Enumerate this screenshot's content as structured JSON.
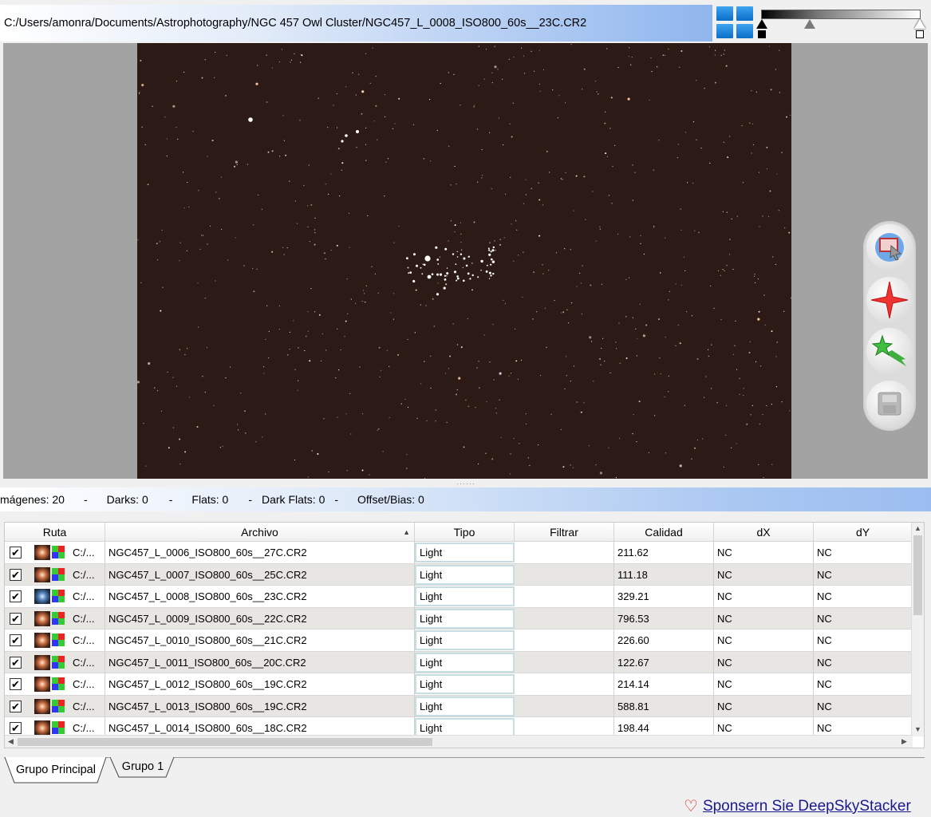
{
  "path_bar": {
    "path": "C:/Users/amonra/Documents/Astrophotography/NGC 457 Owl Cluster/NGC457_L_0008_ISO800_60s__23C.CR2"
  },
  "icons": {
    "tiles": "four-tiles-icon",
    "select_rect": "select-rectangle-icon",
    "star": "star-icon",
    "comet": "comet-icon",
    "save": "save-icon"
  },
  "status": {
    "images": "mágenes: 20",
    "darks": "Darks: 0",
    "flats": "Flats: 0",
    "dark_flats": "Dark Flats: 0",
    "offset": "Offset/Bias: 0",
    "sep": "-"
  },
  "grid": {
    "headers": {
      "ruta": "Ruta",
      "archivo": "Archivo",
      "tipo": "Tipo",
      "filtrar": "Filtrar",
      "calidad": "Calidad",
      "dx": "dX",
      "dy": "dY"
    },
    "rows": [
      {
        "checked": "✔",
        "ruta": "C:/...",
        "archivo": "NGC457_L_0006_ISO800_60s__27C.CR2",
        "tipo": "Light",
        "filtrar": "",
        "calidad": "211.62",
        "dx": "NC",
        "dy": "NC"
      },
      {
        "checked": "✔",
        "ruta": "C:/...",
        "archivo": "NGC457_L_0007_ISO800_60s__25C.CR2",
        "tipo": "Light",
        "filtrar": "",
        "calidad": "111.18",
        "dx": "NC",
        "dy": "NC"
      },
      {
        "checked": "✔",
        "ruta": "C:/...",
        "archivo": "NGC457_L_0008_ISO800_60s__23C.CR2",
        "tipo": "Light",
        "filtrar": "",
        "calidad": "329.21",
        "dx": "NC",
        "dy": "NC"
      },
      {
        "checked": "✔",
        "ruta": "C:/...",
        "archivo": "NGC457_L_0009_ISO800_60s__22C.CR2",
        "tipo": "Light",
        "filtrar": "",
        "calidad": "796.53",
        "dx": "NC",
        "dy": "NC"
      },
      {
        "checked": "✔",
        "ruta": "C:/...",
        "archivo": "NGC457_L_0010_ISO800_60s__21C.CR2",
        "tipo": "Light",
        "filtrar": "",
        "calidad": "226.60",
        "dx": "NC",
        "dy": "NC"
      },
      {
        "checked": "✔",
        "ruta": "C:/...",
        "archivo": "NGC457_L_0011_ISO800_60s__20C.CR2",
        "tipo": "Light",
        "filtrar": "",
        "calidad": "122.67",
        "dx": "NC",
        "dy": "NC"
      },
      {
        "checked": "✔",
        "ruta": "C:/...",
        "archivo": "NGC457_L_0012_ISO800_60s__19C.CR2",
        "tipo": "Light",
        "filtrar": "",
        "calidad": "214.14",
        "dx": "NC",
        "dy": "NC"
      },
      {
        "checked": "✔",
        "ruta": "C:/...",
        "archivo": "NGC457_L_0013_ISO800_60s__19C.CR2",
        "tipo": "Light",
        "filtrar": "",
        "calidad": "588.81",
        "dx": "NC",
        "dy": "NC"
      },
      {
        "checked": "✔",
        "ruta": "C:/...",
        "archivo": "NGC457_L_0014_ISO800_60s__18C.CR2",
        "tipo": "Light",
        "filtrar": "",
        "calidad": "198.44",
        "dx": "NC",
        "dy": "NC"
      }
    ]
  },
  "tabs": [
    "Grupo Principal",
    "Grupo 1"
  ],
  "sponsor": {
    "text": "Sponsern Sie DeepSkyStacker"
  },
  "colors": {
    "sky": "#2b1a16",
    "viewer_bg": "#a3a3a3",
    "status_accent": "#9bbdf0"
  }
}
